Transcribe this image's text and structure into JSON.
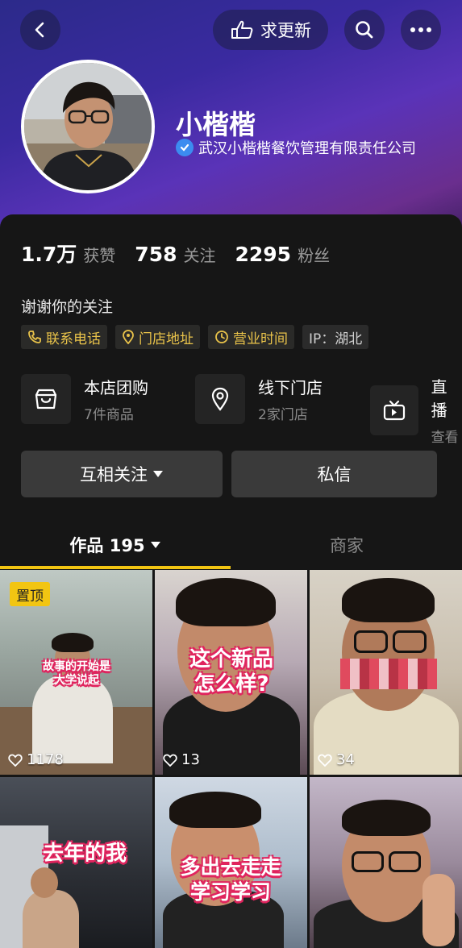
{
  "header": {
    "request_update_label": "求更新",
    "nickname": "小楷楷",
    "company": "武汉小楷楷餐饮管理有限责任公司"
  },
  "stats": [
    {
      "num": "1.7万",
      "label": "获赞"
    },
    {
      "num": "758",
      "label": "关注"
    },
    {
      "num": "2295",
      "label": "粉丝"
    }
  ],
  "bio": "谢谢你的关注",
  "tags": [
    {
      "label": "联系电话",
      "icon": "phone-icon"
    },
    {
      "label": "门店地址",
      "icon": "location-icon"
    },
    {
      "label": "营业时间",
      "icon": "clock-icon"
    },
    {
      "label": "IP：湖北"
    }
  ],
  "services": [
    {
      "title": "本店团购",
      "sub": "7件商品",
      "icon": "shop-bag-icon"
    },
    {
      "title": "线下门店",
      "sub": "2家门店",
      "icon": "map-pin-icon"
    },
    {
      "title": "直播",
      "sub": "查看",
      "icon": "tv-icon"
    }
  ],
  "actions": {
    "follow_label": "互相关注",
    "message_label": "私信"
  },
  "tabs": {
    "works_label": "作品 195",
    "merchant_label": "商家"
  },
  "videos": [
    {
      "likes": "1178",
      "pinned": "置顶",
      "caption_line1": "故事的开始是",
      "caption_line2": "大学说起"
    },
    {
      "likes": "13",
      "caption_line1": "这个新品",
      "caption_line2": "怎么样?"
    },
    {
      "likes": "34"
    },
    {
      "caption_line1": "去年的我"
    },
    {
      "caption_line1": "多出去走走",
      "caption_line2": "学习学习"
    },
    {}
  ],
  "colors": {
    "accent_yellow": "#f2c512",
    "tag_text": "#e9c34a",
    "verified_blue": "#3c8cf0",
    "background": "#161616"
  }
}
